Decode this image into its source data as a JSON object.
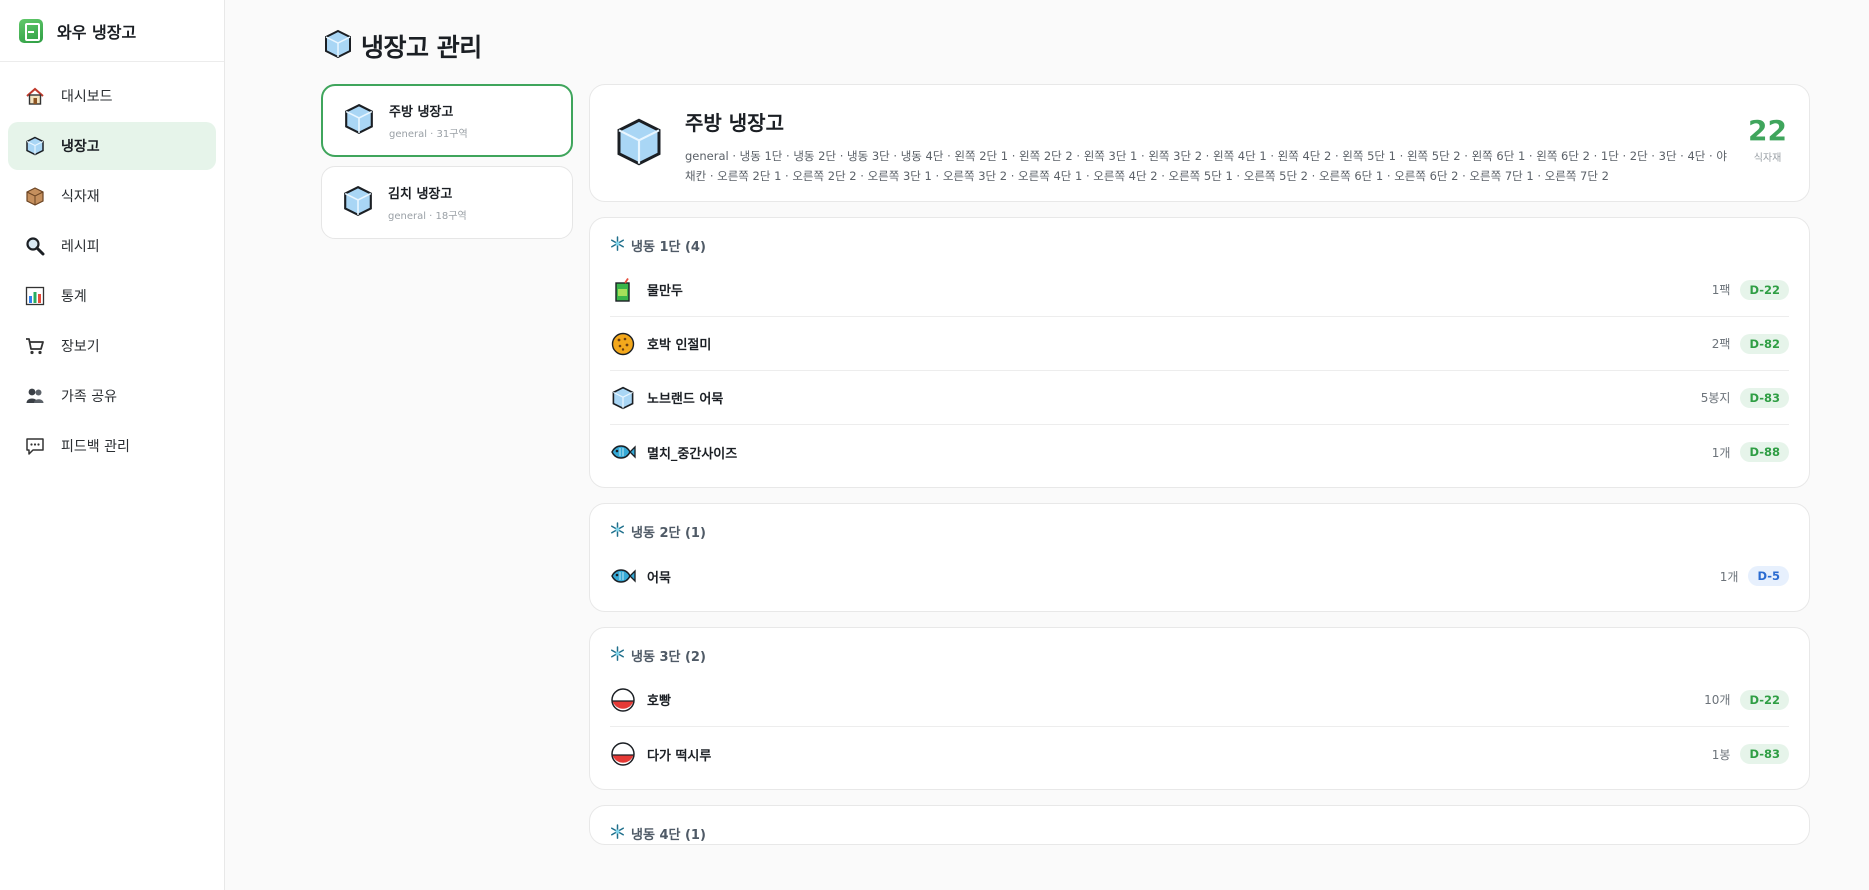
{
  "app": {
    "name": "와우 냉장고"
  },
  "sidebar": {
    "items": [
      {
        "label": "대시보드",
        "icon": "house-icon"
      },
      {
        "label": "냉장고",
        "icon": "ice-cube-icon",
        "active": true
      },
      {
        "label": "식자재",
        "icon": "box-icon"
      },
      {
        "label": "레시피",
        "icon": "magnifier-icon"
      },
      {
        "label": "통계",
        "icon": "bar-chart-icon"
      },
      {
        "label": "장보기",
        "icon": "cart-icon"
      },
      {
        "label": "가족 공유",
        "icon": "people-icon"
      },
      {
        "label": "피드백 관리",
        "icon": "speech-bubble-icon"
      }
    ]
  },
  "page": {
    "title": "냉장고 관리"
  },
  "fridges": [
    {
      "name": "주방 냉장고",
      "meta": "general · 31구역",
      "active": true
    },
    {
      "name": "김치 냉장고",
      "meta": "general · 18구역"
    }
  ],
  "selected": {
    "name": "주방 냉장고",
    "zones": "general · 냉동 1단 · 냉동 2단 · 냉동 3단 · 냉동 4단 · 왼쪽 2단 1 · 왼쪽 2단 2 · 왼쪽 3단 1 · 왼쪽 3단 2 · 왼쪽 4단 1 · 왼쪽 4단 2 · 왼쪽 5단 1 · 왼쪽 5단 2 · 왼쪽 6단 1 · 왼쪽 6단 2 · 1단 · 2단 · 3단 · 4단 · 야채칸 · 오른쪽 2단 1 · 오른쪽 2단 2 · 오른쪽 3단 1 · 오른쪽 3단 2 · 오른쪽 4단 1 · 오른쪽 4단 2 · 오른쪽 5단 1 · 오른쪽 5단 2 · 오른쪽 6단 1 · 오른쪽 6단 2 · 오른쪽 7단 1 · 오른쪽 7단 2",
    "count": "22",
    "count_label": "식자재"
  },
  "sections": [
    {
      "title": "냉동 1단 (4)",
      "items": [
        {
          "name": "물만두",
          "qty": "1팩",
          "dday": "D-22",
          "badge": "green",
          "icon": "juice-box-icon"
        },
        {
          "name": "호박 인절미",
          "qty": "2팩",
          "dday": "D-82",
          "badge": "green",
          "icon": "cookie-icon"
        },
        {
          "name": "노브랜드 어묵",
          "qty": "5봉지",
          "dday": "D-83",
          "badge": "green",
          "icon": "ice-cube-icon"
        },
        {
          "name": "멸치_중간사이즈",
          "qty": "1개",
          "dday": "D-88",
          "badge": "green",
          "icon": "fish-icon"
        }
      ]
    },
    {
      "title": "냉동 2단 (1)",
      "items": [
        {
          "name": "어묵",
          "qty": "1개",
          "dday": "D-5",
          "badge": "blue",
          "icon": "fish-icon"
        }
      ]
    },
    {
      "title": "냉동 3단 (2)",
      "items": [
        {
          "name": "호빵",
          "qty": "10개",
          "dday": "D-22",
          "badge": "green",
          "icon": "rice-cake-icon"
        },
        {
          "name": "다가 떡시루",
          "qty": "1봉",
          "dday": "D-83",
          "badge": "green",
          "icon": "rice-cake-icon"
        }
      ]
    },
    {
      "title": "냉동 4단 (1)",
      "items": []
    }
  ],
  "colors": {
    "accent": "#3fa55c",
    "accent_bg": "#e6f4ea",
    "warn_blue": "#2a6bd1"
  }
}
